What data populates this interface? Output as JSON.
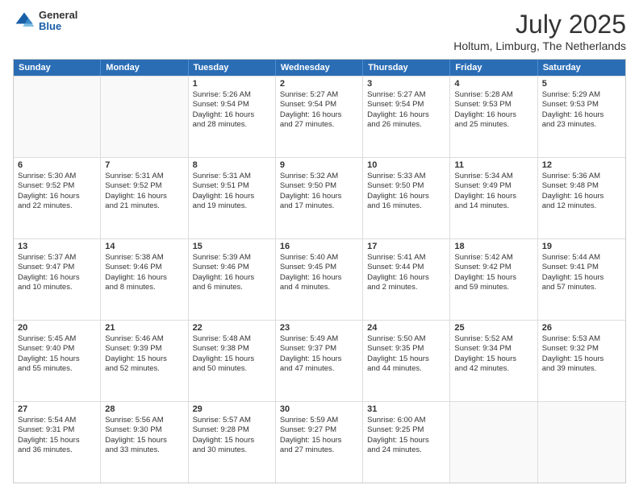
{
  "logo": {
    "general": "General",
    "blue": "Blue"
  },
  "header": {
    "title": "July 2025",
    "subtitle": "Holtum, Limburg, The Netherlands"
  },
  "weekdays": [
    "Sunday",
    "Monday",
    "Tuesday",
    "Wednesday",
    "Thursday",
    "Friday",
    "Saturday"
  ],
  "rows": [
    [
      {
        "day": "",
        "empty": true,
        "lines": []
      },
      {
        "day": "",
        "empty": true,
        "lines": []
      },
      {
        "day": "1",
        "lines": [
          "Sunrise: 5:26 AM",
          "Sunset: 9:54 PM",
          "Daylight: 16 hours",
          "and 28 minutes."
        ]
      },
      {
        "day": "2",
        "lines": [
          "Sunrise: 5:27 AM",
          "Sunset: 9:54 PM",
          "Daylight: 16 hours",
          "and 27 minutes."
        ]
      },
      {
        "day": "3",
        "lines": [
          "Sunrise: 5:27 AM",
          "Sunset: 9:54 PM",
          "Daylight: 16 hours",
          "and 26 minutes."
        ]
      },
      {
        "day": "4",
        "lines": [
          "Sunrise: 5:28 AM",
          "Sunset: 9:53 PM",
          "Daylight: 16 hours",
          "and 25 minutes."
        ]
      },
      {
        "day": "5",
        "lines": [
          "Sunrise: 5:29 AM",
          "Sunset: 9:53 PM",
          "Daylight: 16 hours",
          "and 23 minutes."
        ]
      }
    ],
    [
      {
        "day": "6",
        "lines": [
          "Sunrise: 5:30 AM",
          "Sunset: 9:52 PM",
          "Daylight: 16 hours",
          "and 22 minutes."
        ]
      },
      {
        "day": "7",
        "lines": [
          "Sunrise: 5:31 AM",
          "Sunset: 9:52 PM",
          "Daylight: 16 hours",
          "and 21 minutes."
        ]
      },
      {
        "day": "8",
        "lines": [
          "Sunrise: 5:31 AM",
          "Sunset: 9:51 PM",
          "Daylight: 16 hours",
          "and 19 minutes."
        ]
      },
      {
        "day": "9",
        "lines": [
          "Sunrise: 5:32 AM",
          "Sunset: 9:50 PM",
          "Daylight: 16 hours",
          "and 17 minutes."
        ]
      },
      {
        "day": "10",
        "lines": [
          "Sunrise: 5:33 AM",
          "Sunset: 9:50 PM",
          "Daylight: 16 hours",
          "and 16 minutes."
        ]
      },
      {
        "day": "11",
        "lines": [
          "Sunrise: 5:34 AM",
          "Sunset: 9:49 PM",
          "Daylight: 16 hours",
          "and 14 minutes."
        ]
      },
      {
        "day": "12",
        "lines": [
          "Sunrise: 5:36 AM",
          "Sunset: 9:48 PM",
          "Daylight: 16 hours",
          "and 12 minutes."
        ]
      }
    ],
    [
      {
        "day": "13",
        "lines": [
          "Sunrise: 5:37 AM",
          "Sunset: 9:47 PM",
          "Daylight: 16 hours",
          "and 10 minutes."
        ]
      },
      {
        "day": "14",
        "lines": [
          "Sunrise: 5:38 AM",
          "Sunset: 9:46 PM",
          "Daylight: 16 hours",
          "and 8 minutes."
        ]
      },
      {
        "day": "15",
        "lines": [
          "Sunrise: 5:39 AM",
          "Sunset: 9:46 PM",
          "Daylight: 16 hours",
          "and 6 minutes."
        ]
      },
      {
        "day": "16",
        "lines": [
          "Sunrise: 5:40 AM",
          "Sunset: 9:45 PM",
          "Daylight: 16 hours",
          "and 4 minutes."
        ]
      },
      {
        "day": "17",
        "lines": [
          "Sunrise: 5:41 AM",
          "Sunset: 9:44 PM",
          "Daylight: 16 hours",
          "and 2 minutes."
        ]
      },
      {
        "day": "18",
        "lines": [
          "Sunrise: 5:42 AM",
          "Sunset: 9:42 PM",
          "Daylight: 15 hours",
          "and 59 minutes."
        ]
      },
      {
        "day": "19",
        "lines": [
          "Sunrise: 5:44 AM",
          "Sunset: 9:41 PM",
          "Daylight: 15 hours",
          "and 57 minutes."
        ]
      }
    ],
    [
      {
        "day": "20",
        "lines": [
          "Sunrise: 5:45 AM",
          "Sunset: 9:40 PM",
          "Daylight: 15 hours",
          "and 55 minutes."
        ]
      },
      {
        "day": "21",
        "lines": [
          "Sunrise: 5:46 AM",
          "Sunset: 9:39 PM",
          "Daylight: 15 hours",
          "and 52 minutes."
        ]
      },
      {
        "day": "22",
        "lines": [
          "Sunrise: 5:48 AM",
          "Sunset: 9:38 PM",
          "Daylight: 15 hours",
          "and 50 minutes."
        ]
      },
      {
        "day": "23",
        "lines": [
          "Sunrise: 5:49 AM",
          "Sunset: 9:37 PM",
          "Daylight: 15 hours",
          "and 47 minutes."
        ]
      },
      {
        "day": "24",
        "lines": [
          "Sunrise: 5:50 AM",
          "Sunset: 9:35 PM",
          "Daylight: 15 hours",
          "and 44 minutes."
        ]
      },
      {
        "day": "25",
        "lines": [
          "Sunrise: 5:52 AM",
          "Sunset: 9:34 PM",
          "Daylight: 15 hours",
          "and 42 minutes."
        ]
      },
      {
        "day": "26",
        "lines": [
          "Sunrise: 5:53 AM",
          "Sunset: 9:32 PM",
          "Daylight: 15 hours",
          "and 39 minutes."
        ]
      }
    ],
    [
      {
        "day": "27",
        "lines": [
          "Sunrise: 5:54 AM",
          "Sunset: 9:31 PM",
          "Daylight: 15 hours",
          "and 36 minutes."
        ]
      },
      {
        "day": "28",
        "lines": [
          "Sunrise: 5:56 AM",
          "Sunset: 9:30 PM",
          "Daylight: 15 hours",
          "and 33 minutes."
        ]
      },
      {
        "day": "29",
        "lines": [
          "Sunrise: 5:57 AM",
          "Sunset: 9:28 PM",
          "Daylight: 15 hours",
          "and 30 minutes."
        ]
      },
      {
        "day": "30",
        "lines": [
          "Sunrise: 5:59 AM",
          "Sunset: 9:27 PM",
          "Daylight: 15 hours",
          "and 27 minutes."
        ]
      },
      {
        "day": "31",
        "lines": [
          "Sunrise: 6:00 AM",
          "Sunset: 9:25 PM",
          "Daylight: 15 hours",
          "and 24 minutes."
        ]
      },
      {
        "day": "",
        "empty": true,
        "lines": []
      },
      {
        "day": "",
        "empty": true,
        "lines": []
      }
    ]
  ]
}
